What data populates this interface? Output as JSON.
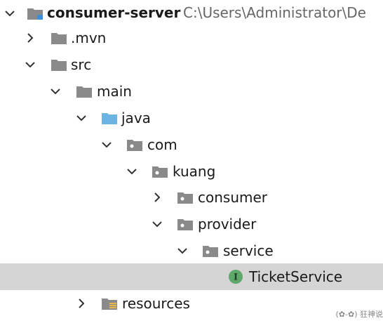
{
  "tree": {
    "project": {
      "name": "consumer-server",
      "path": "C:\\Users\\Administrator\\De"
    },
    "nodes": [
      {
        "label": ".mvn",
        "icon": "folder-icon",
        "state": "collapsed"
      },
      {
        "label": "src",
        "icon": "folder-icon",
        "state": "expanded"
      },
      {
        "label": "main",
        "icon": "folder-icon",
        "state": "expanded"
      },
      {
        "label": "java",
        "icon": "source-folder-icon",
        "state": "expanded"
      },
      {
        "label": "com",
        "icon": "package-icon",
        "state": "expanded"
      },
      {
        "label": "kuang",
        "icon": "package-icon",
        "state": "expanded"
      },
      {
        "label": "consumer",
        "icon": "package-icon",
        "state": "collapsed"
      },
      {
        "label": "provider",
        "icon": "package-icon",
        "state": "expanded"
      },
      {
        "label": "service",
        "icon": "package-icon",
        "state": "expanded"
      },
      {
        "label": "TicketService",
        "icon": "interface-icon",
        "state": "leaf",
        "selected": true
      },
      {
        "label": "resources",
        "icon": "resources-folder-icon",
        "state": "collapsed"
      }
    ]
  },
  "watermark": {
    "text": "(✿-✿) 狂神说"
  },
  "colors": {
    "folder": "#8a8a8a",
    "source_folder": "#6cb4e4",
    "interface_badge": "#5fa86b",
    "selection": "#d5d5d5"
  }
}
